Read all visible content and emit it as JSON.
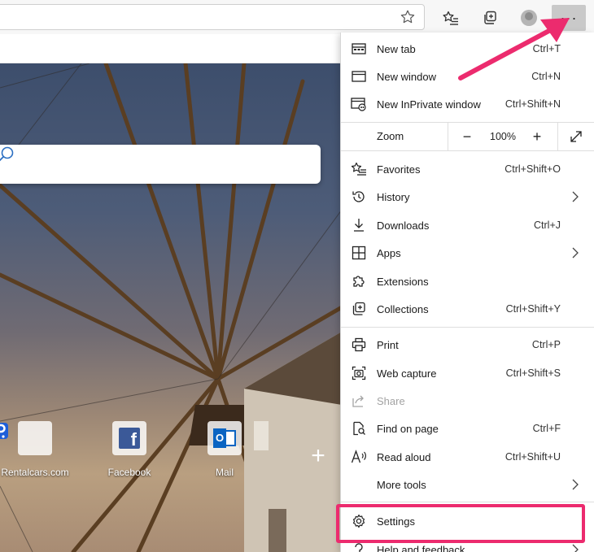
{
  "toolbar": {
    "favorite_icon": "star-outline-icon",
    "favorites_icon": "favorites-list-icon",
    "collections_icon": "collections-icon",
    "profile_icon": "profile-avatar-icon",
    "more_label": "···"
  },
  "page": {
    "search_icon": "search-icon",
    "tiles": [
      {
        "label": "Rentalcars.com",
        "icon": "rentalcars-logo"
      },
      {
        "label": "Facebook",
        "icon": "facebook-logo",
        "letter": "f"
      },
      {
        "label": "Mail",
        "icon": "outlook-mail-logo",
        "letter": "O"
      }
    ],
    "add_tile": "+"
  },
  "menu": {
    "new_tab": {
      "label": "New tab",
      "shortcut": "Ctrl+T"
    },
    "new_window": {
      "label": "New window",
      "shortcut": "Ctrl+N"
    },
    "new_inprivate": {
      "label": "New InPrivate window",
      "shortcut": "Ctrl+Shift+N"
    },
    "zoom": {
      "label": "Zoom",
      "minus": "−",
      "value": "100%",
      "plus": "+"
    },
    "favorites": {
      "label": "Favorites",
      "shortcut": "Ctrl+Shift+O"
    },
    "history": {
      "label": "History"
    },
    "downloads": {
      "label": "Downloads",
      "shortcut": "Ctrl+J"
    },
    "apps": {
      "label": "Apps"
    },
    "extensions": {
      "label": "Extensions"
    },
    "collections": {
      "label": "Collections",
      "shortcut": "Ctrl+Shift+Y"
    },
    "print": {
      "label": "Print",
      "shortcut": "Ctrl+P"
    },
    "web_capture": {
      "label": "Web capture",
      "shortcut": "Ctrl+Shift+S"
    },
    "share": {
      "label": "Share"
    },
    "find_on_page": {
      "label": "Find on page",
      "shortcut": "Ctrl+F"
    },
    "read_aloud": {
      "label": "Read aloud",
      "shortcut": "Ctrl+Shift+U"
    },
    "more_tools": {
      "label": "More tools"
    },
    "settings": {
      "label": "Settings"
    },
    "help": {
      "label": "Help and feedback"
    }
  },
  "annotation": {
    "highlight_color": "#ec2b6e",
    "arrow_color": "#ec2b6e"
  }
}
